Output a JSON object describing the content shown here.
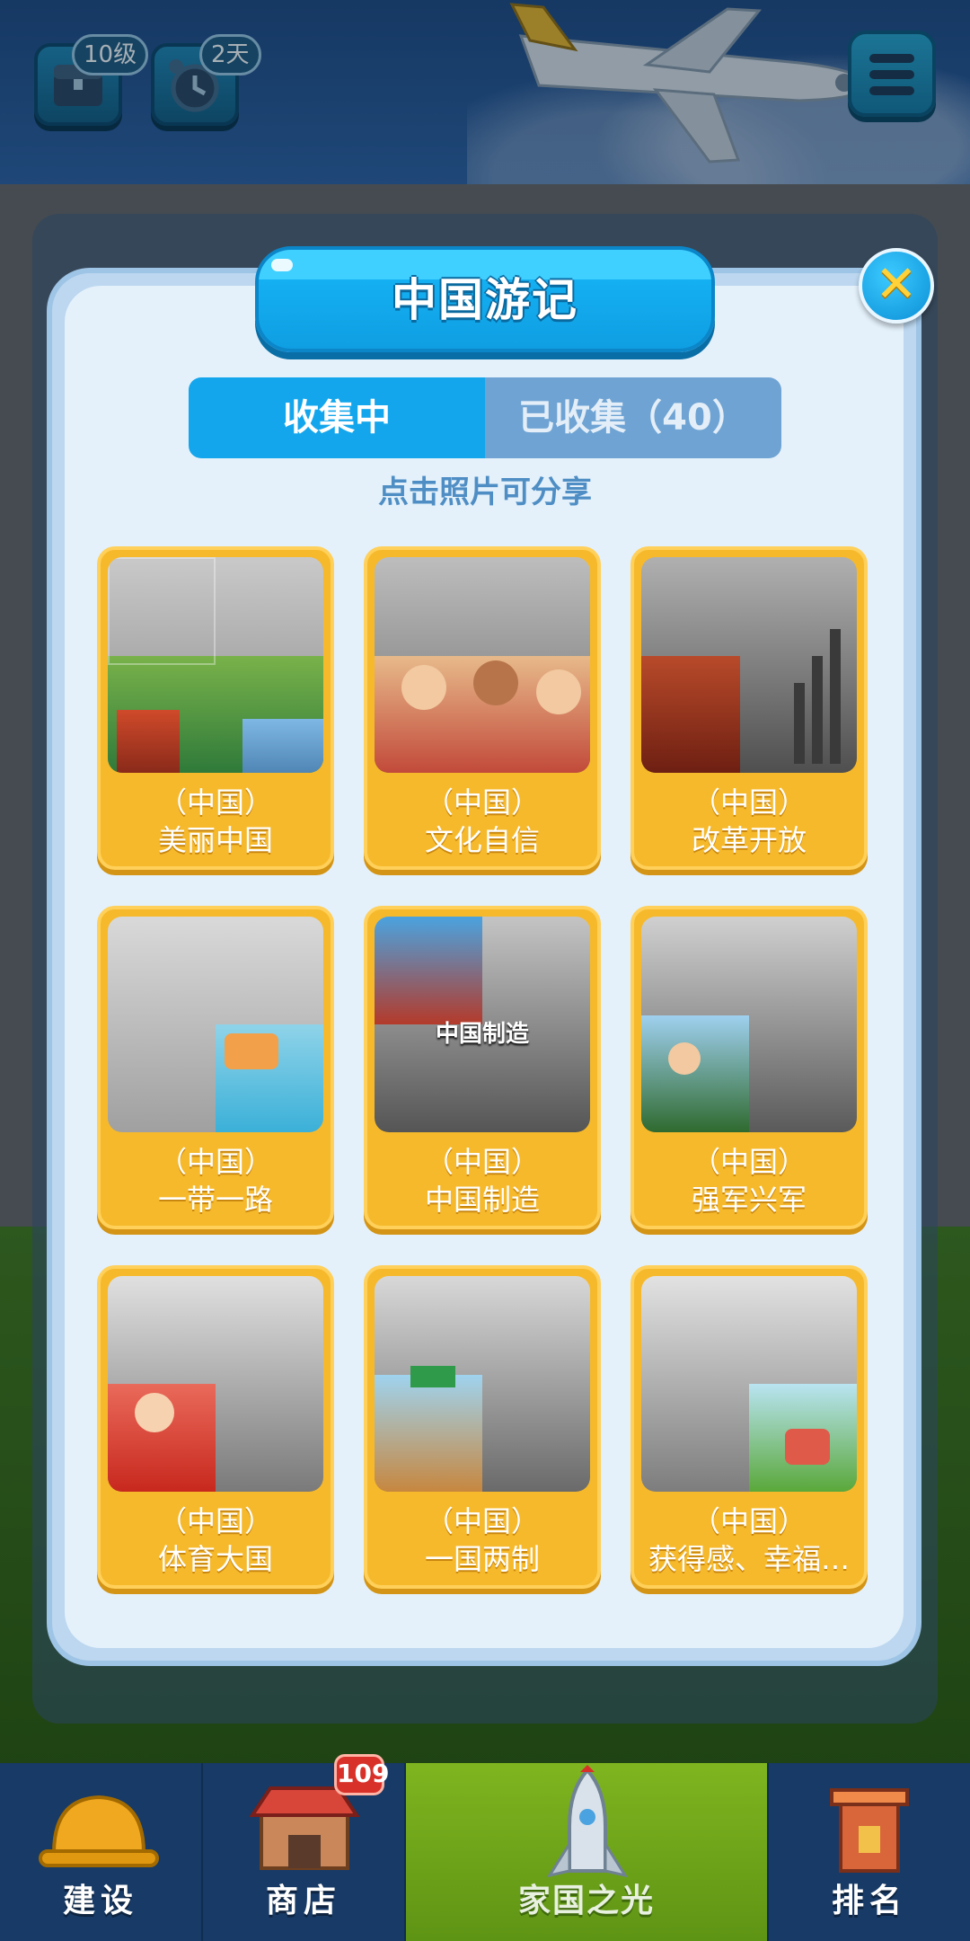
{
  "hud": {
    "chest_badge": "10级",
    "clock_badge": "2天"
  },
  "modal": {
    "title": "中国游记",
    "tabs": [
      {
        "label": "收集中",
        "active": true
      },
      {
        "label": "已收集（40）",
        "active": false
      }
    ],
    "hint": "点击照片可分享",
    "cards": [
      {
        "line1": "（中国）",
        "line2": "美丽中国"
      },
      {
        "line1": "（中国）",
        "line2": "文化自信"
      },
      {
        "line1": "（中国）",
        "line2": "改革开放"
      },
      {
        "line1": "（中国）",
        "line2": "一带一路"
      },
      {
        "line1": "（中国）",
        "line2": "中国制造",
        "overlay": "中国制造"
      },
      {
        "line1": "（中国）",
        "line2": "强军兴军"
      },
      {
        "line1": "（中国）",
        "line2": "体育大国"
      },
      {
        "line1": "（中国）",
        "line2": "一国两制"
      },
      {
        "line1": "（中国）",
        "line2": "获得感、幸福…"
      }
    ]
  },
  "bottom_nav": {
    "items": [
      {
        "label": "建设",
        "icon": "hard-hat-icon"
      },
      {
        "label": "商店",
        "icon": "shop-icon",
        "badge": "109"
      },
      {
        "label": "家国之光",
        "icon": "rocket-icon",
        "active": true
      },
      {
        "label": "排名",
        "icon": "ranking-tower-icon"
      }
    ]
  },
  "colors": {
    "accent": "#14a6ec",
    "card": "#f6b92b",
    "modal_bg": "#e4f1fb"
  }
}
